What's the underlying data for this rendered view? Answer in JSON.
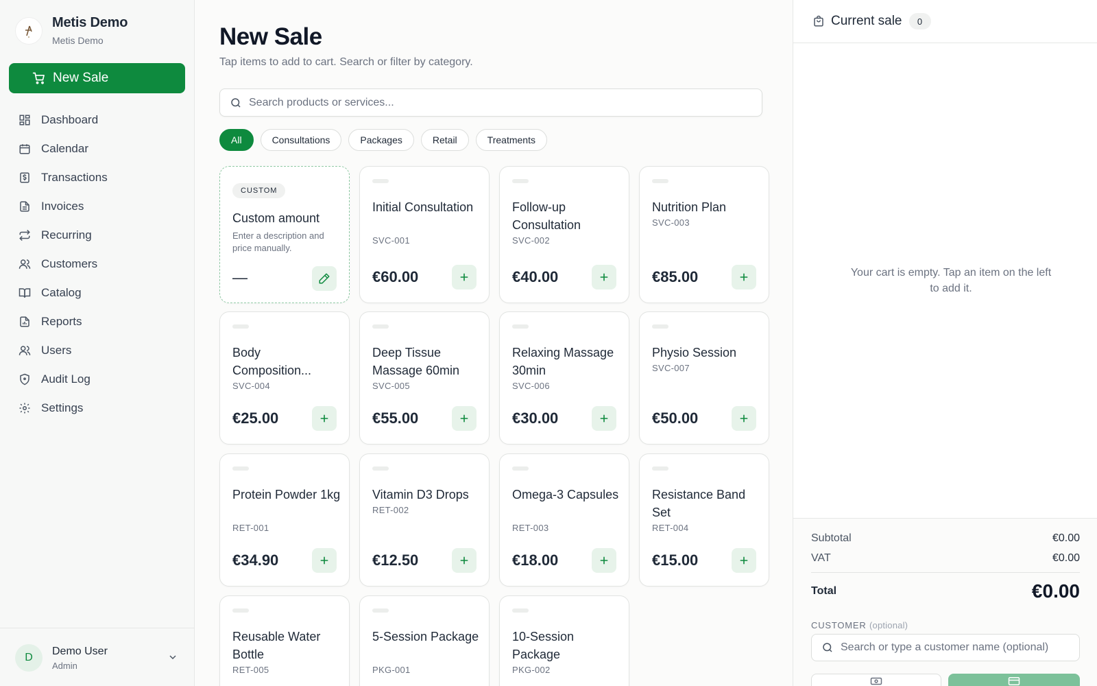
{
  "brand": {
    "title": "Metis Demo",
    "subtitle": "Metis Demo"
  },
  "sidebar": {
    "new_sale_label": "New Sale",
    "items": [
      {
        "label": "Dashboard",
        "icon": "dashboard-icon"
      },
      {
        "label": "Calendar",
        "icon": "calendar-icon"
      },
      {
        "label": "Transactions",
        "icon": "transactions-icon"
      },
      {
        "label": "Invoices",
        "icon": "invoices-icon"
      },
      {
        "label": "Recurring",
        "icon": "recurring-icon"
      },
      {
        "label": "Customers",
        "icon": "customers-icon"
      },
      {
        "label": "Catalog",
        "icon": "catalog-icon"
      },
      {
        "label": "Reports",
        "icon": "reports-icon"
      },
      {
        "label": "Users",
        "icon": "users-icon"
      },
      {
        "label": "Audit Log",
        "icon": "shield-icon"
      },
      {
        "label": "Settings",
        "icon": "gear-icon"
      }
    ],
    "user": {
      "initial": "D",
      "name": "Demo User",
      "role": "Admin"
    }
  },
  "main": {
    "title": "New Sale",
    "subtitle": "Tap items to add to cart. Search or filter by category.",
    "search_placeholder": "Search products or services...",
    "filters": [
      "All",
      "Consultations",
      "Packages",
      "Retail",
      "Treatments"
    ],
    "active_filter": "All",
    "custom_card": {
      "badge": "CUSTOM",
      "name": "Custom amount",
      "description": "Enter a description and price manually.",
      "price": "—"
    },
    "products": [
      {
        "name": "Initial Consultation",
        "sku": "SVC-001",
        "price": "€60.00"
      },
      {
        "name": "Follow-up Consultation",
        "sku": "SVC-002",
        "price": "€40.00"
      },
      {
        "name": "Nutrition Plan",
        "sku": "SVC-003",
        "price": "€85.00"
      },
      {
        "name": "Body Composition...",
        "sku": "SVC-004",
        "price": "€25.00"
      },
      {
        "name": "Deep Tissue Massage 60min",
        "sku": "SVC-005",
        "price": "€55.00"
      },
      {
        "name": "Relaxing Massage 30min",
        "sku": "SVC-006",
        "price": "€30.00"
      },
      {
        "name": "Physio Session",
        "sku": "SVC-007",
        "price": "€50.00"
      },
      {
        "name": "Protein Powder 1kg",
        "sku": "RET-001",
        "price": "€34.90"
      },
      {
        "name": "Vitamin D3 Drops",
        "sku": "RET-002",
        "price": "€12.50"
      },
      {
        "name": "Omega-3 Capsules",
        "sku": "RET-003",
        "price": "€18.00"
      },
      {
        "name": "Resistance Band Set",
        "sku": "RET-004",
        "price": "€15.00"
      },
      {
        "name": "Reusable Water Bottle",
        "sku": "RET-005",
        "price": ""
      },
      {
        "name": "5-Session Package",
        "sku": "PKG-001",
        "price": ""
      },
      {
        "name": "10-Session Package",
        "sku": "PKG-002",
        "price": ""
      }
    ]
  },
  "cart": {
    "title": "Current sale",
    "count": "0",
    "empty_message": "Your cart is empty. Tap an item on the left to add it.",
    "subtotal_label": "Subtotal",
    "subtotal": "€0.00",
    "vat_label": "VAT",
    "vat": "€0.00",
    "total_label": "Total",
    "total": "€0.00",
    "customer_label": "CUSTOMER",
    "customer_optional": "(optional)",
    "customer_placeholder": "Search or type a customer name (optional)"
  },
  "colors": {
    "accent": "#0e8a3e",
    "accent_soft": "#e7f3ea"
  }
}
